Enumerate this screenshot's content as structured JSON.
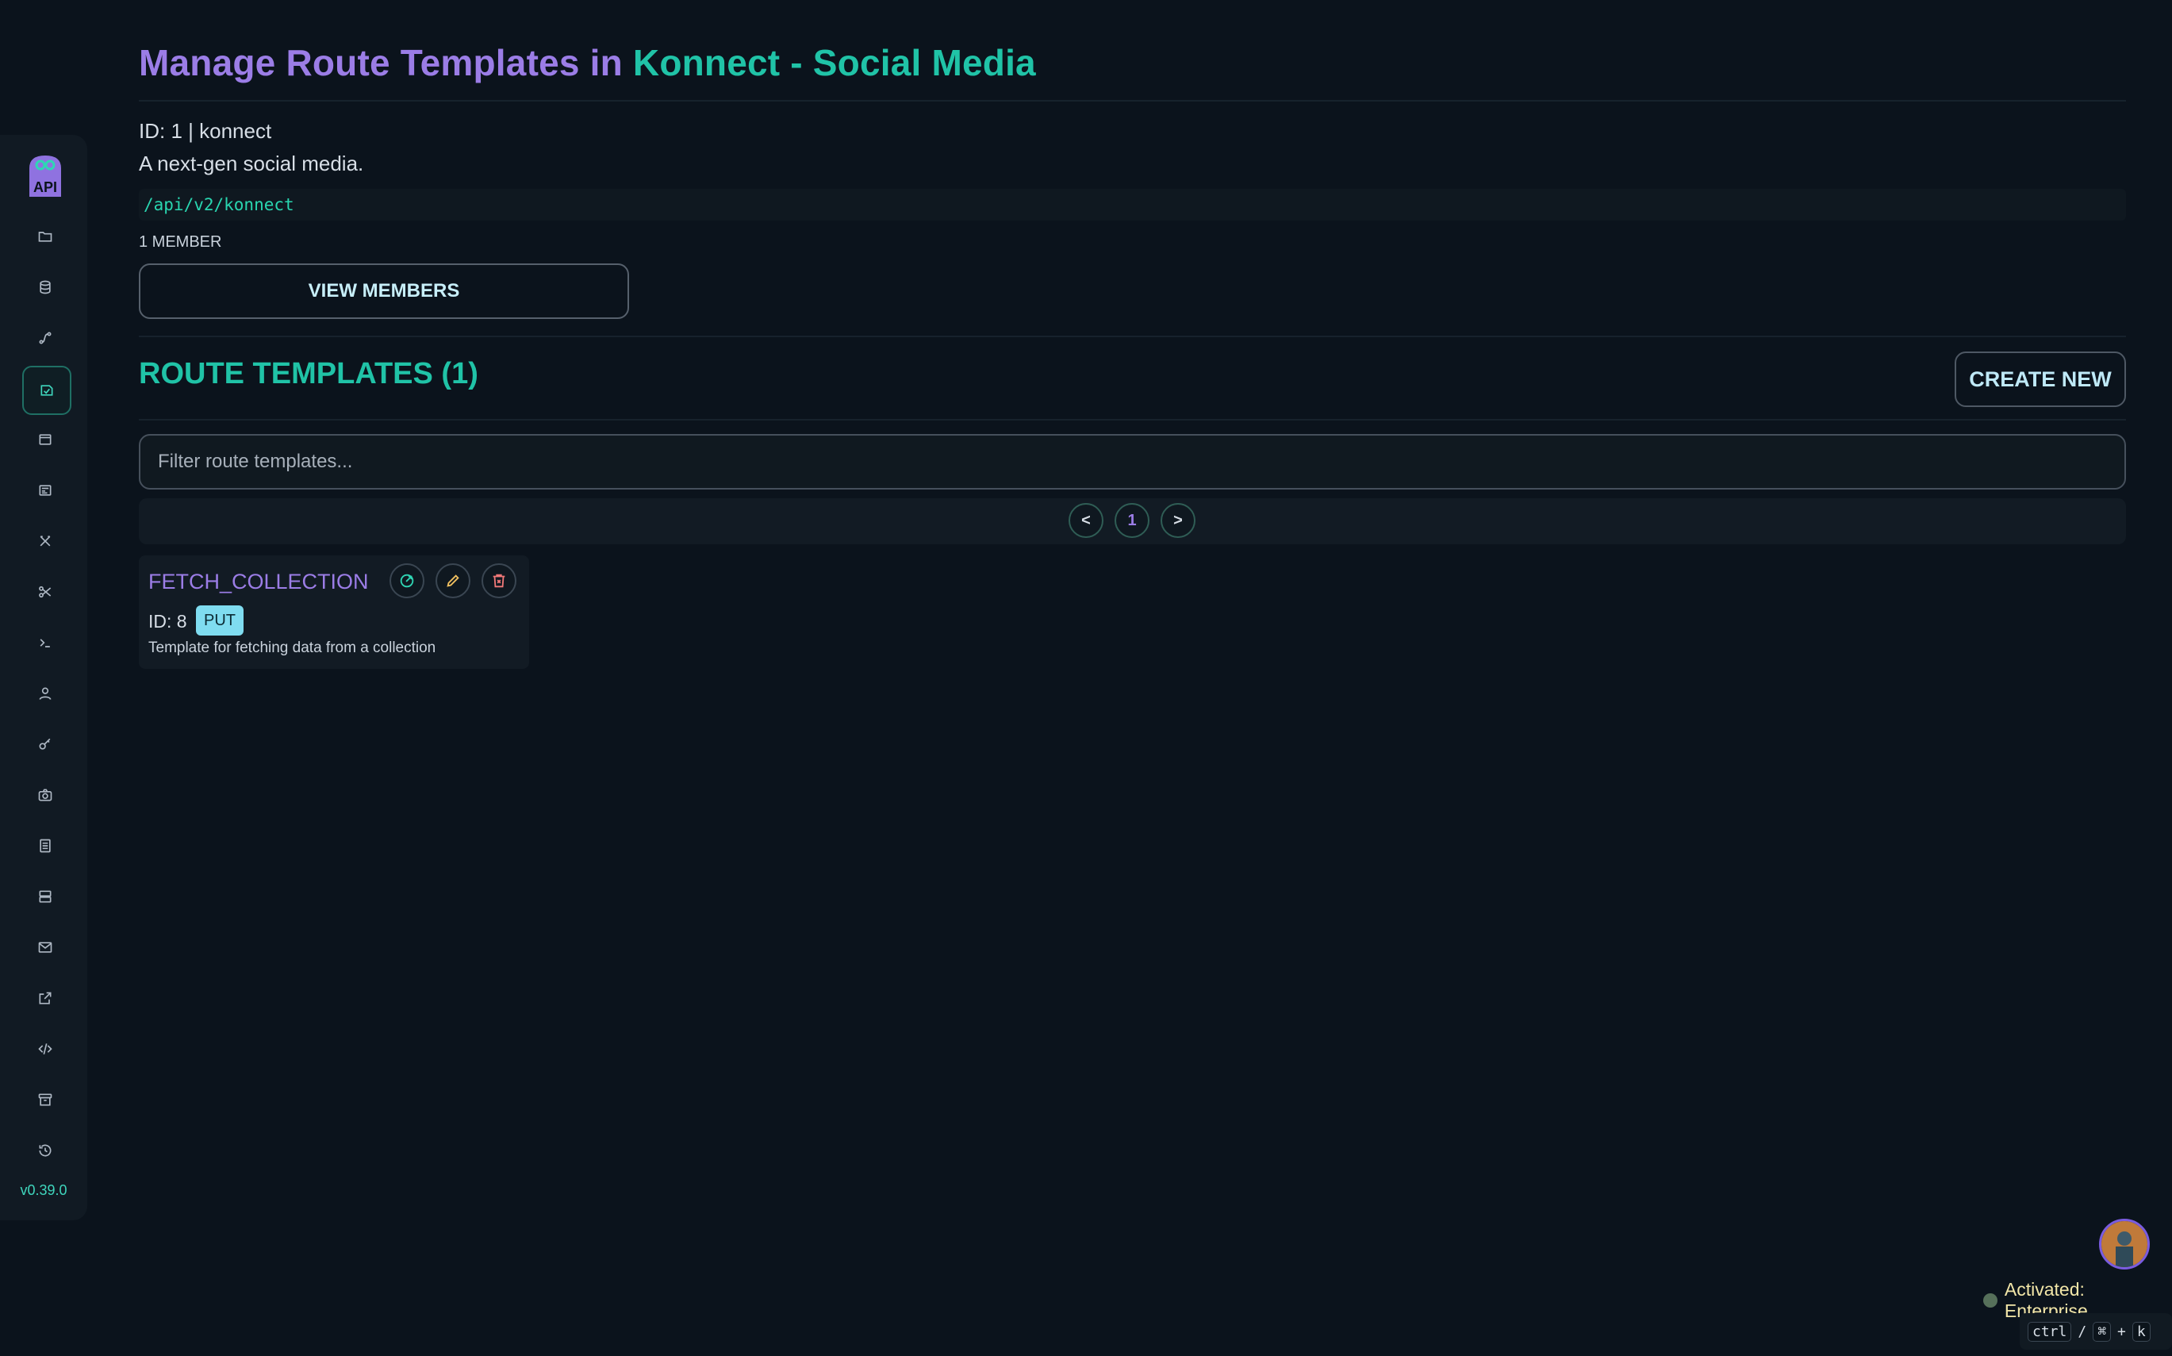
{
  "page": {
    "title_part1": "Manage Route Templates in",
    "title_part2": "Konnect - Social Media",
    "id_line": "ID: 1 | konnect",
    "description": "A next-gen social media.",
    "api_path": "/api/v2/konnect",
    "members_count": "1 MEMBER",
    "view_members_label": "VIEW MEMBERS",
    "section_title": "ROUTE TEMPLATES (1)",
    "create_new_label": "CREATE NEW",
    "filter_placeholder": "Filter route templates..."
  },
  "pagination": {
    "prev": "<",
    "current": "1",
    "next": ">"
  },
  "templates": [
    {
      "name": "FETCH_COLLECTION",
      "id_label": "ID: 8",
      "method": "PUT",
      "description": "Template for fetching data from a collection"
    }
  ],
  "sidebar": {
    "logo_text": "API",
    "version": "v0.39.0",
    "items": [
      {
        "icon": "folder-icon"
      },
      {
        "icon": "database-icon"
      },
      {
        "icon": "route-icon"
      },
      {
        "icon": "route-template-icon",
        "active": true
      },
      {
        "icon": "window-icon"
      },
      {
        "icon": "form-icon"
      },
      {
        "icon": "tools-icon"
      },
      {
        "icon": "scissors-icon"
      },
      {
        "icon": "terminal-icon"
      },
      {
        "icon": "user-icon"
      },
      {
        "icon": "key-icon"
      },
      {
        "icon": "camera-icon"
      },
      {
        "icon": "document-icon"
      },
      {
        "icon": "server-icon"
      },
      {
        "icon": "mail-icon"
      },
      {
        "icon": "external-link-icon"
      },
      {
        "icon": "code-icon"
      },
      {
        "icon": "archive-icon"
      },
      {
        "icon": "history-icon"
      }
    ]
  },
  "footer": {
    "status_text": "Activated: Enterprise",
    "shortcut_ctrl": "ctrl",
    "shortcut_sep": "/",
    "shortcut_cmd": "⌘",
    "shortcut_plus": "+",
    "shortcut_key": "k"
  },
  "colors": {
    "accent_purple": "#9b7de6",
    "accent_teal": "#20c3a7",
    "background": "#0b131c",
    "badge_put": "#7fdcf0"
  }
}
